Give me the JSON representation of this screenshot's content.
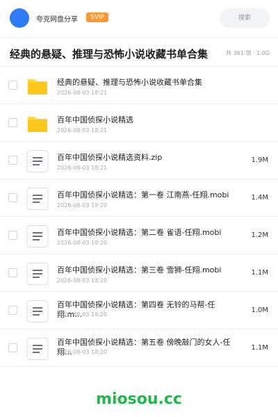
{
  "header": {
    "brand": "夸克网盘分享",
    "badge": "SVIP",
    "search_placeholder": "搜索"
  },
  "title_bar": {
    "title": "经典的悬疑、推理与恐怖小说收藏书单合集",
    "summary": "共 361 项 · 1.0G"
  },
  "files": [
    {
      "name": "经典的悬疑、推理与恐怖小说收藏书单合集",
      "date": "2026-08-03 18:21",
      "size": "",
      "type": "folder"
    },
    {
      "name": "百年中国侦探小说精选",
      "date": "2026-08-03 18:21",
      "size": "",
      "type": "folder"
    },
    {
      "name": "百年中国侦探小说精选资料.zip",
      "date": "2026-08-03 18:21",
      "size": "1.9M",
      "type": "document"
    },
    {
      "name": "百年中国侦探小说精选：第一卷 江南燕-任翔.mobi",
      "date": "2026-08-03 18:20",
      "size": "1.4M",
      "type": "document"
    },
    {
      "name": "百年中国侦探小说精选：第二卷 雀语-任翔.mobi",
      "date": "2026-08-03 18:20",
      "size": "1.2M",
      "type": "document"
    },
    {
      "name": "百年中国侦探小说精选：第三卷 雪狮-任翔.mobi",
      "date": "2026-08-03 18:20",
      "size": "1.1M",
      "type": "document"
    },
    {
      "name": "百年中国侦探小说精选：第四卷 无铃的马帮-任翔.m…",
      "date": "2026-08-03 18:20",
      "size": "1.0M",
      "type": "document"
    },
    {
      "name": "百年中国侦探小说精选：第五卷 傍晚敲门的女人-任翔…",
      "date": "2026-08-03 18:20",
      "size": "1.1M",
      "type": "document"
    }
  ],
  "footer": {
    "watermark": "miosou.cc"
  },
  "colors": {
    "accent": "#2f7bf5",
    "badge": "#f79a36",
    "folder": "#ffc81e",
    "watermark": "#25b54a"
  }
}
